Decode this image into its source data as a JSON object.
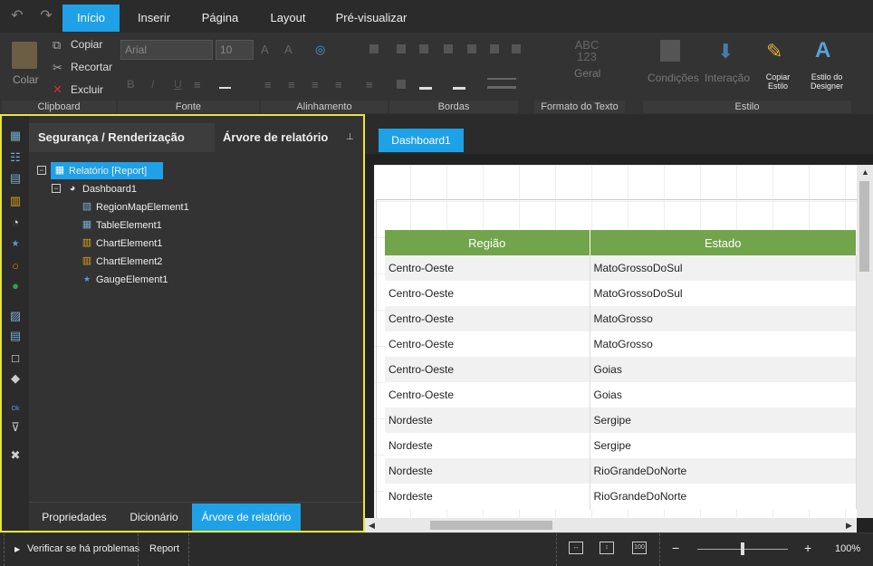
{
  "menu": {
    "tabs": [
      "Início",
      "Inserir",
      "Página",
      "Layout",
      "Pré-visualizar"
    ],
    "active_tab": "Início"
  },
  "ribbon": {
    "clipboard": {
      "paste": "Colar",
      "copy": "Copiar",
      "cut": "Recortar",
      "delete": "Excluir"
    },
    "font": {
      "family": "Arial",
      "size": "10",
      "bold": "B",
      "italic": "I",
      "underline": "U"
    },
    "format": {
      "sample": "ABC\n123",
      "label": "Geral"
    },
    "conditions": "Condições",
    "interaction": "Interação",
    "copy_style": "Copiar Estilo",
    "designer_style": "Estilo do Designer",
    "groups": [
      "Clipboard",
      "Fonte",
      "Alinhamento",
      "Bordas",
      "Formato do Texto",
      "Estilo"
    ]
  },
  "left_panel": {
    "tabs": [
      "Segurança / Renderização",
      "Árvore de relatório"
    ],
    "pin_icon": "pin-icon",
    "tree": [
      {
        "label": "Relatório [Report]",
        "level": 0,
        "icon": "report-icon",
        "selected": true
      },
      {
        "label": "Dashboard1",
        "level": 1,
        "icon": "dashboard-icon"
      },
      {
        "label": "RegionMapElement1",
        "level": 2,
        "icon": "map-icon"
      },
      {
        "label": "TableElement1",
        "level": 2,
        "icon": "table-icon"
      },
      {
        "label": "ChartElement1",
        "level": 2,
        "icon": "chart-icon"
      },
      {
        "label": "ChartElement2",
        "level": 2,
        "icon": "chart-icon"
      },
      {
        "label": "GaugeElement1",
        "level": 2,
        "icon": "gauge-icon"
      }
    ],
    "bottom_tabs": [
      "Propriedades",
      "Dicionário",
      "Árvore de relatório"
    ],
    "active_bottom_tab": "Árvore de relatório"
  },
  "document": {
    "tab": "Dashboard1",
    "table": {
      "headers": [
        "Região",
        "Estado"
      ],
      "rows": [
        [
          "Centro-Oeste",
          "MatoGrossoDoSul"
        ],
        [
          "Centro-Oeste",
          "MatoGrossoDoSul"
        ],
        [
          "Centro-Oeste",
          "MatoGrosso"
        ],
        [
          "Centro-Oeste",
          "MatoGrosso"
        ],
        [
          "Centro-Oeste",
          "Goias"
        ],
        [
          "Centro-Oeste",
          "Goias"
        ],
        [
          "Nordeste",
          "Sergipe"
        ],
        [
          "Nordeste",
          "Sergipe"
        ],
        [
          "Nordeste",
          "RioGrandeDoNorte"
        ],
        [
          "Nordeste",
          "RioGrandeDoNorte"
        ]
      ],
      "header_color": "#71a44b"
    }
  },
  "status": {
    "check_problems": "Verificar se há problemas",
    "report": "Report",
    "zoom": "100%",
    "zoom_level": 0.5
  },
  "colors": {
    "accent": "#1ea1e6",
    "highlight_border": "#e6e63a"
  }
}
